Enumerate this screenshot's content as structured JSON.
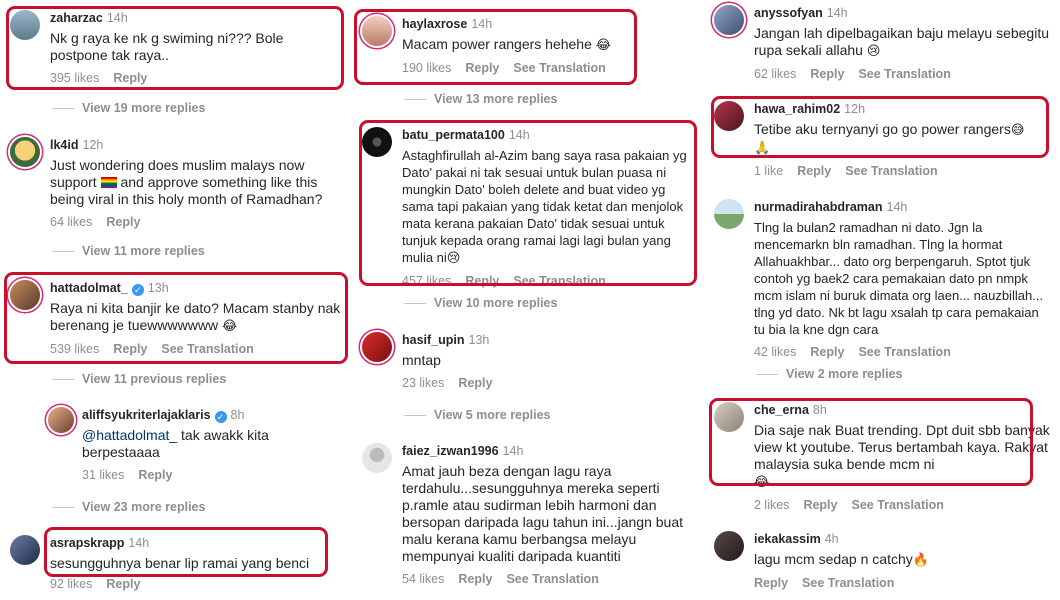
{
  "columns": [
    {
      "comments": [
        {
          "user": "zaharzac",
          "time": "14h",
          "verified": false,
          "text": "Nk g raya ke nk g swiming ni??? Bole postpone tak raya..",
          "likes": "395 likes",
          "reply": "Reply",
          "translate": ""
        },
        {
          "user": "lk4id",
          "time": "12h",
          "verified": false,
          "text_before": "Just wondering does muslim malays now support",
          "text_after": "and approve something like this being viral in this holy month of Ramadhan?",
          "likes": "64 likes",
          "reply": "Reply",
          "translate": ""
        },
        {
          "user": "hattadolmat_",
          "time": "13h",
          "verified": true,
          "text": "Raya ni kita banjir ke dato? Macam stanby nak berenang je tuewwwwwww",
          "likes": "539 likes",
          "reply": "Reply",
          "translate": "See Translation"
        },
        {
          "user": "aliffsyukriterlajaklaris",
          "time": "8h",
          "verified": true,
          "mention": "@hattadolmat_",
          "text": "tak awakk kita berpestaaaa",
          "likes": "31 likes",
          "reply": "Reply",
          "translate": ""
        },
        {
          "user": "asrapskrapp",
          "time": "14h",
          "verified": false,
          "text": "sesungguhnya benar lip ramai yang benci",
          "likes": "92 likes",
          "reply": "Reply",
          "translate": ""
        }
      ],
      "more": [
        "View 19 more replies",
        "View 11 more replies",
        "View 11 previous replies",
        "View 23 more replies"
      ]
    },
    {
      "comments": [
        {
          "user": "haylaxrose",
          "time": "14h",
          "text": "Macam power rangers hehehe",
          "likes": "190 likes",
          "reply": "Reply",
          "translate": "See Translation"
        },
        {
          "user": "batu_permata100",
          "time": "14h",
          "text": "Astaghfirullah al-Azim bang saya rasa pakaian yg Dato' pakai ni tak sesuai untuk bulan puasa ni mungkin Dato' boleh delete and buat video yg sama tapi pakaian yang tidak ketat dan menjolok mata kerana pakaian Dato' tidak sesuai untuk tunjuk kepada orang ramai lagi lagi bulan yang mulia ni",
          "likes": "457 likes",
          "reply": "Reply",
          "translate": "See Translation"
        },
        {
          "user": "hasif_upin",
          "time": "13h",
          "text": "mntap",
          "likes": "23 likes",
          "reply": "Reply",
          "translate": ""
        },
        {
          "user": "faiez_izwan1996",
          "time": "14h",
          "text": "Amat jauh beza dengan lagu raya terdahulu...sesungguhnya mereka seperti p.ramle atau sudirman lebih harmoni dan bersopan daripada lagu tahun ini...jangn buat malu kerana kamu berbangsa melayu mempunyai kualiti daripada kuantiti",
          "likes": "54 likes",
          "reply": "Reply",
          "translate": "See Translation"
        }
      ],
      "more": [
        "View 13 more replies",
        "View 10 more replies",
        "View 5 more replies"
      ]
    },
    {
      "comments": [
        {
          "user": "anyssofyan",
          "time": "14h",
          "text": "Jangan lah dipelbagaikan baju melayu sebegitu rupa sekali allahu",
          "likes": "62 likes",
          "reply": "Reply",
          "translate": "See Translation"
        },
        {
          "user": "hawa_rahim02",
          "time": "12h",
          "text": "Tetibe aku ternyanyi go go power rangers",
          "likes": "1 like",
          "reply": "Reply",
          "translate": "See Translation"
        },
        {
          "user": "nurmadirahabdraman",
          "time": "14h",
          "text": "Tlng la bulan2 ramadhan ni dato. Jgn la mencemarkn bln ramadhan. Tlng la hormat Allahuakhbar... dato org berpengaruh. Sptot tjuk contoh yg baek2 cara pemakaian dato pn nmpk mcm islam ni buruk dimata org laen... nauzbillah... tlng yd dato. Nk bt lagu xsalah tp cara pemakaian tu bia la kne dgn cara",
          "likes": "42 likes",
          "reply": "Reply",
          "translate": "See Translation"
        },
        {
          "user": "che_erna",
          "time": "8h",
          "text": "Dia saje nak Buat trending. Dpt duit sbb banyak view kt youtube. Terus bertambah kaya. Rakyat malaysia suka bende mcm ni",
          "likes": "2 likes",
          "reply": "Reply",
          "translate": "See Translation"
        },
        {
          "user": "iekakassim",
          "time": "4h",
          "text": "lagu mcm sedap n catchy",
          "likes": "",
          "reply": "Reply",
          "translate": "See Translation"
        }
      ],
      "more": [
        "View 2 more replies"
      ]
    }
  ],
  "colors": {
    "highlight": "#c8102e",
    "username": "#262626",
    "meta": "#8e8e8e",
    "mention": "#00376b"
  },
  "icons": [
    "verified-badge-icon",
    "laughing-emoji-icon",
    "sweat-smile-emoji-icon",
    "sad-emoji-icon",
    "pray-emoji-icon",
    "fire-emoji-icon",
    "rainbow-flag-icon"
  ]
}
